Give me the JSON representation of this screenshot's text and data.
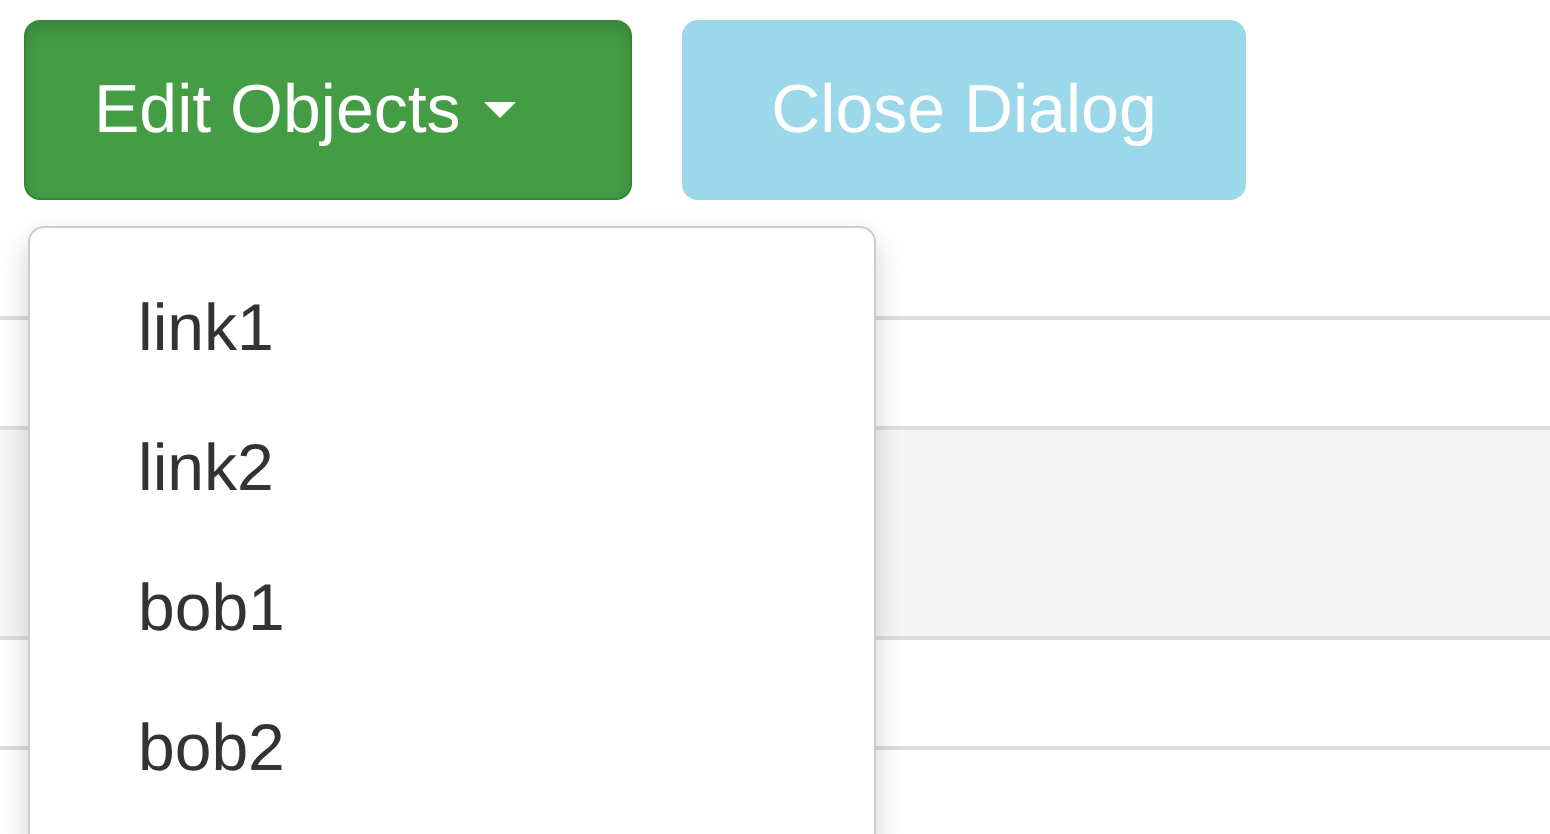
{
  "buttons": [
    {
      "label": "Edit Objects",
      "kind": "dropdown",
      "expanded": true,
      "disabled": false
    },
    {
      "label": "Close Dialog",
      "kind": "plain",
      "disabled": true
    }
  ],
  "menu": {
    "items": [
      {
        "label": "link1"
      },
      {
        "label": "link2"
      },
      {
        "label": "bob1"
      },
      {
        "label": "bob2"
      }
    ]
  }
}
